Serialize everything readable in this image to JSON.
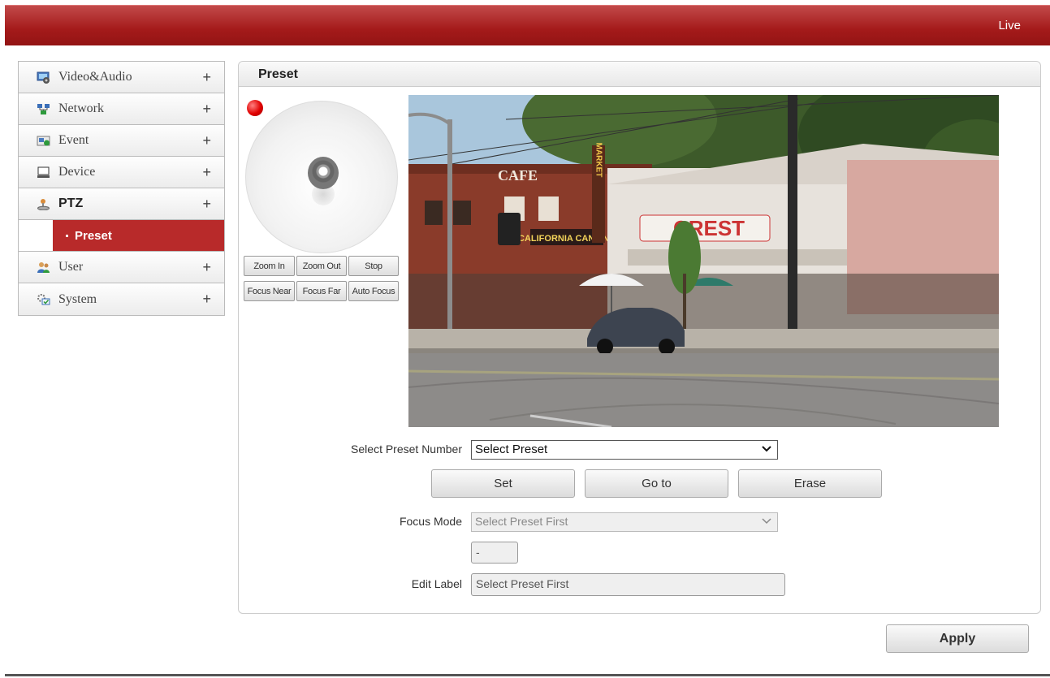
{
  "header": {
    "live_label": "Live"
  },
  "sidebar": {
    "items": [
      {
        "label": "Video&Audio",
        "icon": "video-audio-icon",
        "expand": "+"
      },
      {
        "label": "Network",
        "icon": "network-icon",
        "expand": "+"
      },
      {
        "label": "Event",
        "icon": "event-icon",
        "expand": "+"
      },
      {
        "label": "Device",
        "icon": "device-icon",
        "expand": "+"
      },
      {
        "label": "PTZ",
        "icon": "ptz-icon",
        "expand": "+"
      },
      {
        "label": "User",
        "icon": "user-icon",
        "expand": "+"
      },
      {
        "label": "System",
        "icon": "system-icon",
        "expand": "+"
      }
    ],
    "sub_selected": "Preset"
  },
  "panel": {
    "title": "Preset"
  },
  "ptz_controls": {
    "zoom_in": "Zoom In",
    "zoom_out": "Zoom Out",
    "stop": "Stop",
    "focus_near": "Focus Near",
    "focus_far": "Focus Far",
    "auto_focus": "Auto Focus"
  },
  "video": {
    "signs": {
      "cafe": "CAFE",
      "market": "MARKET",
      "crest": "CREST",
      "california": "CALIFORNIA CANTINA"
    }
  },
  "preset_form": {
    "select_preset_label": "Select Preset Number",
    "select_preset_value": "Select Preset",
    "set_label": "Set",
    "goto_label": "Go to",
    "erase_label": "Erase",
    "focus_mode_label": "Focus Mode",
    "focus_mode_value": "Select Preset First",
    "focus_value": "-",
    "edit_label_label": "Edit Label",
    "edit_label_value": "Select Preset First"
  },
  "footer": {
    "apply_label": "Apply"
  },
  "colors": {
    "brand_red": "#a41a1a",
    "selected_red": "#b82a2a"
  }
}
